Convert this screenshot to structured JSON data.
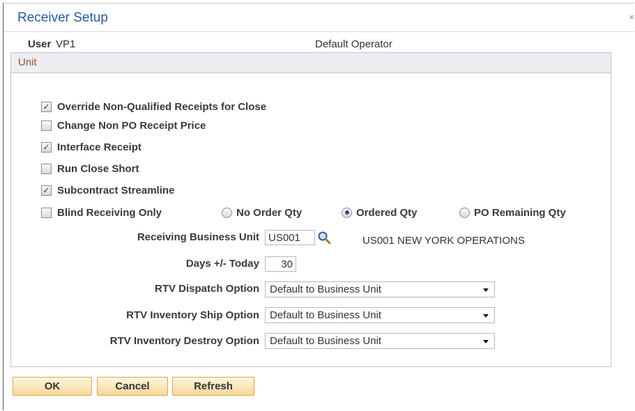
{
  "dialog": {
    "title": "Receiver Setup",
    "close_glyph": "×"
  },
  "user": {
    "label": "User",
    "value": "VP1",
    "description": "Default Operator"
  },
  "panel": {
    "title": "Unit"
  },
  "checkboxes": [
    {
      "label": "Override Non-Qualified Receipts for Close",
      "checked": true
    },
    {
      "label": "Change Non PO Receipt Price",
      "checked": false
    },
    {
      "label": "Interface Receipt",
      "checked": true
    },
    {
      "label": "Run Close Short",
      "checked": false
    },
    {
      "label": "Subcontract Streamline",
      "checked": true
    },
    {
      "label": "Blind Receiving Only",
      "checked": false
    }
  ],
  "radios": [
    {
      "label": "No Order Qty",
      "selected": false
    },
    {
      "label": "Ordered Qty",
      "selected": true
    },
    {
      "label": "PO Remaining Qty",
      "selected": false
    }
  ],
  "fields": {
    "business_unit": {
      "label": "Receiving Business Unit",
      "value": "US001",
      "description": "US001 NEW YORK OPERATIONS"
    },
    "days": {
      "label": "Days +/- Today",
      "value": "30"
    },
    "rtv_dispatch": {
      "label": "RTV Dispatch Option",
      "value": "Default to Business Unit"
    },
    "rtv_ship": {
      "label": "RTV Inventory Ship Option",
      "value": "Default to Business Unit"
    },
    "rtv_destroy": {
      "label": "RTV Inventory Destroy Option",
      "value": "Default to Business Unit"
    }
  },
  "buttons": {
    "ok": "OK",
    "cancel": "Cancel",
    "refresh": "Refresh"
  },
  "icons": {
    "lookup": "magnifier-icon",
    "checkmark": "✓"
  },
  "colors": {
    "title": "#2a5b9a",
    "panel_title": "#a0522d",
    "button_border": "#d9a54a"
  }
}
